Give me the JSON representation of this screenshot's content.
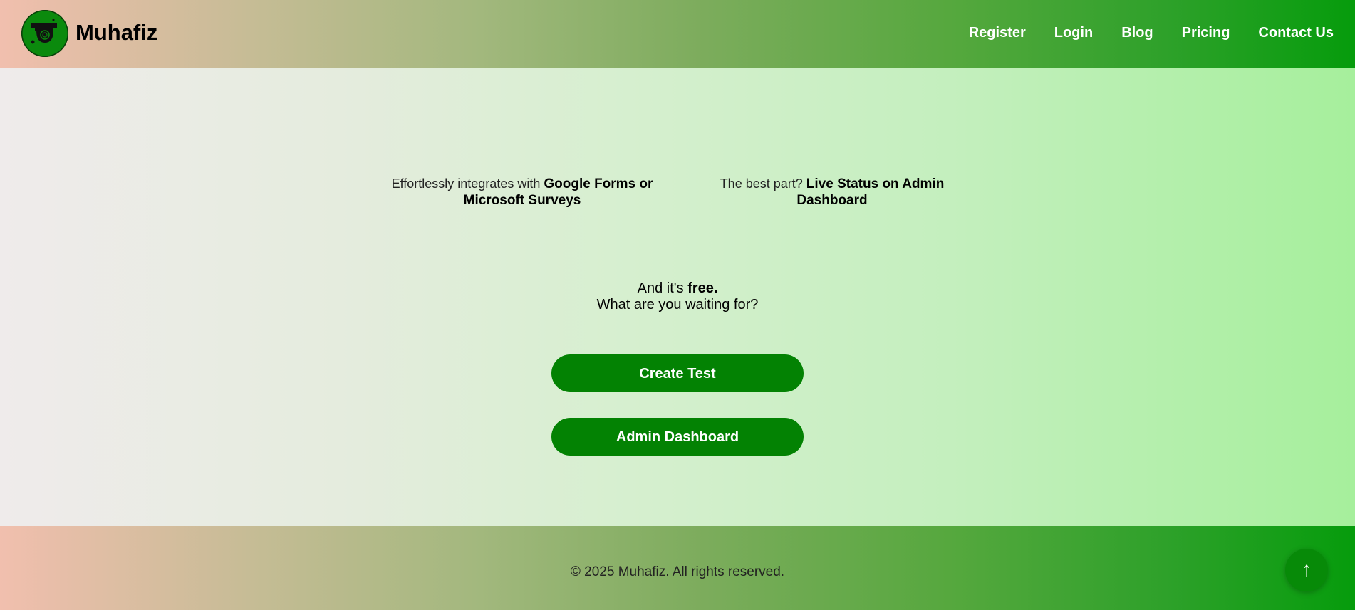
{
  "header": {
    "brand": "Muhafiz",
    "logo_icon": "security-camera-icon",
    "nav": [
      {
        "label": "Register"
      },
      {
        "label": "Login"
      },
      {
        "label": "Blog"
      },
      {
        "label": "Pricing"
      },
      {
        "label": "Contact Us"
      }
    ]
  },
  "features": [
    {
      "prefix": "Effortlessly integrates with ",
      "highlight": "Google Forms or Microsoft Surveys"
    },
    {
      "prefix": "The best part? ",
      "highlight": "Live Status on Admin Dashboard"
    }
  ],
  "cta": {
    "line1_prefix": "And it's ",
    "line1_bold": "free.",
    "line2": "What are you waiting for?"
  },
  "buttons": {
    "create_test": "Create Test",
    "admin_dashboard": "Admin Dashboard"
  },
  "footer": {
    "copyright": "© 2025 Muhafiz. All rights reserved.",
    "scroll_top_symbol": "↑",
    "scroll_top_icon": "arrow-up-icon"
  },
  "colors": {
    "accent_green": "#038203",
    "gradient_start": "#f1bfae",
    "gradient_end": "#069c0c"
  }
}
